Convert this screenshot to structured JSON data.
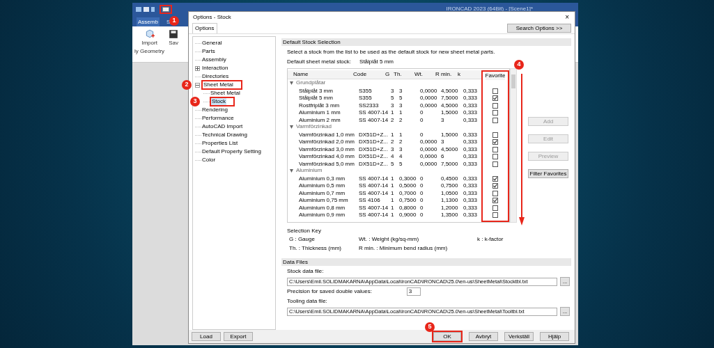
{
  "app": {
    "title": "IRONCAD 2023 (64Bit) - [Scene1]*",
    "window_icon_annotation": "1",
    "ribbon_tabs": [
      {
        "label": "Assemb",
        "selected": true
      },
      {
        "label": "S",
        "selected": false
      }
    ],
    "ribbon_buttons": [
      {
        "label": "Import",
        "sub": "ly Geometry"
      },
      {
        "label": "Sav"
      }
    ]
  },
  "dialog": {
    "title": "Options - Stock",
    "close": "×",
    "tab": "Options",
    "search_button": "Search Options >>",
    "tree": [
      {
        "label": "General",
        "selected": false
      },
      {
        "label": "Parts",
        "selected": false
      },
      {
        "label": "Assembly",
        "selected": false
      },
      {
        "label": "Interaction",
        "selected": false,
        "expanded": false
      },
      {
        "label": "Directories",
        "selected": false
      },
      {
        "label": "Sheet Metal",
        "selected": false,
        "expanded": true,
        "annotation": "2",
        "children": [
          {
            "label": "Sheet Metal",
            "selected": false
          },
          {
            "label": "Stock",
            "selected": true,
            "annotation": "3"
          }
        ]
      },
      {
        "label": "Rendering",
        "selected": false
      },
      {
        "label": "Performance",
        "selected": false
      },
      {
        "label": "AutoCAD Import",
        "selected": false
      },
      {
        "label": "Technical Drawing",
        "selected": false
      },
      {
        "label": "Properties List",
        "selected": false
      },
      {
        "label": "Default Property Setting",
        "selected": false
      },
      {
        "label": "Color",
        "selected": false
      }
    ],
    "stock_section": {
      "header": "Default Stock Selection",
      "instruction": "Select a stock from the list to be used as the default stock for new sheet metal parts.",
      "default_label": "Default sheet metal stock:",
      "default_value": "Stålplåt 5 mm",
      "columns": [
        "Name",
        "Code",
        "G",
        "Th.",
        "Wt.",
        "R min.",
        "k"
      ],
      "favorite_column": "Favorite",
      "favorite_annotation": "4",
      "groups": [
        {
          "name": "Grundplåtar",
          "expanded": true,
          "rows": [
            {
              "name": "Stålplåt 3 mm",
              "code": "S355",
              "g": "3",
              "th": "3",
              "wt": "0,0000",
              "rmin": "4,5000",
              "k": "0,333",
              "favorite": false
            },
            {
              "name": "Stålplåt 5 mm",
              "code": "S355",
              "g": "5",
              "th": "5",
              "wt": "0,0000",
              "rmin": "7,5000",
              "k": "0,333",
              "favorite": true
            },
            {
              "name": "Rostfriplåt 3 mm",
              "code": "SS2333",
              "g": "3",
              "th": "3",
              "wt": "0,0000",
              "rmin": "4,5000",
              "k": "0,333",
              "favorite": false
            },
            {
              "name": "Aluminium 1 mm",
              "code": "SS 4007-14",
              "g": "1",
              "th": "1",
              "wt": "0",
              "rmin": "1,5000",
              "k": "0,333",
              "favorite": false
            },
            {
              "name": "Aluminium 2 mm",
              "code": "SS 4007-14",
              "g": "2",
              "th": "2",
              "wt": "0",
              "rmin": "3",
              "k": "0,333",
              "favorite": false
            }
          ]
        },
        {
          "name": "Varmförzinkad",
          "expanded": true,
          "rows": [
            {
              "name": "Varmförzinkad 1,0 mm",
              "code": "DX51D+Z...",
              "g": "1",
              "th": "1",
              "wt": "0",
              "rmin": "1,5000",
              "k": "0,333",
              "favorite": false
            },
            {
              "name": "Varmförzinkad 2,0 mm",
              "code": "DX51D+Z...",
              "g": "2",
              "th": "2",
              "wt": "0,0000",
              "rmin": "3",
              "k": "0,333",
              "favorite": true
            },
            {
              "name": "Varmförzinkad 3,0 mm",
              "code": "DX51D+Z...",
              "g": "3",
              "th": "3",
              "wt": "0,0000",
              "rmin": "4,5000",
              "k": "0,333",
              "favorite": false
            },
            {
              "name": "Varmförzinkad 4,0 mm",
              "code": "DX51D+Z...",
              "g": "4",
              "th": "4",
              "wt": "0,0000",
              "rmin": "6",
              "k": "0,333",
              "favorite": false
            },
            {
              "name": "Varmförzinkad 5,0 mm",
              "code": "DX51D+Z...",
              "g": "5",
              "th": "5",
              "wt": "0,0000",
              "rmin": "7,5000",
              "k": "0,333",
              "favorite": false
            }
          ]
        },
        {
          "name": "Aluminium",
          "expanded": true,
          "rows": [
            {
              "name": "Aluminium 0,3 mm",
              "code": "SS 4007-14",
              "g": "1",
              "th": "0,3000",
              "wt": "0",
              "rmin": "0,4500",
              "k": "0,333",
              "favorite": true
            },
            {
              "name": "Aluminium 0,5 mm",
              "code": "SS 4007-14",
              "g": "1",
              "th": "0,5000",
              "wt": "0",
              "rmin": "0,7500",
              "k": "0,333",
              "favorite": true
            },
            {
              "name": "Aluminium 0,7 mm",
              "code": "SS 4007-14",
              "g": "1",
              "th": "0,7000",
              "wt": "0",
              "rmin": "1,0500",
              "k": "0,333",
              "favorite": false
            },
            {
              "name": "Aluminium 0,75 mm",
              "code": "SS 4106",
              "g": "1",
              "th": "0,7500",
              "wt": "0",
              "rmin": "1,1300",
              "k": "0,333",
              "favorite": true
            },
            {
              "name": "Aluminium 0,8 mm",
              "code": "SS 4007-14",
              "g": "1",
              "th": "0,8000",
              "wt": "0",
              "rmin": "1,2000",
              "k": "0,333",
              "favorite": false
            },
            {
              "name": "Aluminium 0,9 mm",
              "code": "SS 4007-14",
              "g": "1",
              "th": "0,9000",
              "wt": "0",
              "rmin": "1,3500",
              "k": "0,333",
              "favorite": false
            }
          ]
        }
      ],
      "side_buttons": [
        {
          "label": "Add",
          "disabled": true
        },
        {
          "label": "Edit",
          "disabled": true
        },
        {
          "label": "Preview",
          "disabled": true
        },
        {
          "label": "Filter Favorites",
          "disabled": false
        }
      ],
      "key_title": "Selection Key",
      "key": [
        "G : Gauge",
        "Wt. : Weight (kg/sq-mm)",
        "k : k-factor",
        "Th. : Thickness (mm)",
        "R min. : Minimum bend radius (mm)"
      ]
    },
    "data_files": {
      "header": "Data Files",
      "stock_label": "Stock data file:",
      "stock_value": "C:\\Users\\Emil.SOLIDMAKARNA\\AppData\\Local\\IronCAD\\IRONCAD\\25.0\\en-us\\SheetMetal\\Stocktbl.txt",
      "browse": "...",
      "precision_label": "Precision for saved double values:",
      "precision_value": "3",
      "tooling_label": "Tooling data file:",
      "tooling_value": "C:\\Users\\Emil.SOLIDMAKARNA\\AppData\\Local\\IronCAD\\IRONCAD\\25.0\\en-us\\SheetMetal\\Tooltbl.txt",
      "browse2": "..."
    },
    "left_buttons": [
      "Load",
      "Export"
    ],
    "right_buttons": [
      {
        "label": "OK",
        "annotation": "5"
      },
      {
        "label": "Avbryt"
      },
      {
        "label": "Verkställ"
      },
      {
        "label": "Hjälp"
      }
    ]
  }
}
